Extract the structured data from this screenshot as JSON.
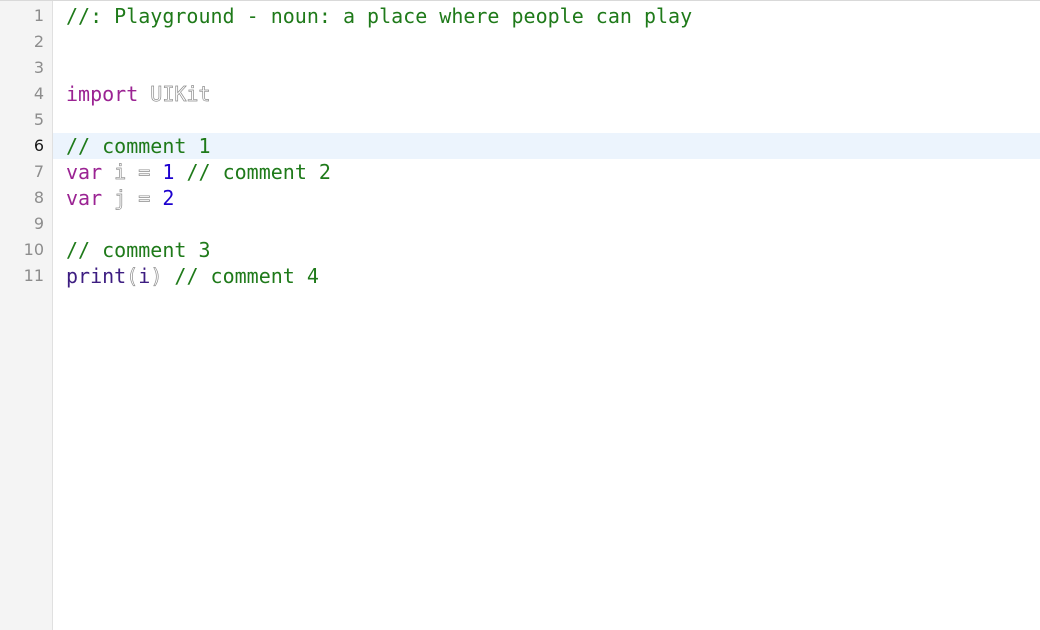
{
  "editor": {
    "current_line": 6,
    "lines": [
      {
        "number": "1",
        "tokens": {
          "comment": "//: Playground - noun: a place where people can play"
        }
      },
      {
        "number": "2",
        "tokens": {}
      },
      {
        "number": "3",
        "tokens": {}
      },
      {
        "number": "4",
        "tokens": {
          "keyword": "import",
          "module": "UIKit"
        }
      },
      {
        "number": "5",
        "tokens": {}
      },
      {
        "number": "6",
        "tokens": {
          "comment": "// comment 1"
        }
      },
      {
        "number": "7",
        "tokens": {
          "keyword": "var",
          "name": "i",
          "equals": "=",
          "value": "1",
          "comment": "// comment 2"
        }
      },
      {
        "number": "8",
        "tokens": {
          "keyword": "var",
          "name": "j",
          "equals": "=",
          "value": "2"
        }
      },
      {
        "number": "9",
        "tokens": {}
      },
      {
        "number": "10",
        "tokens": {
          "comment": "// comment 3"
        }
      },
      {
        "number": "11",
        "tokens": {
          "func": "print",
          "open": "(",
          "arg": "i",
          "close": ")",
          "comment": "// comment 4"
        }
      }
    ]
  },
  "colors": {
    "comment": "#1f7a1a",
    "keyword": "#9b2393",
    "number": "#1c00cf",
    "function": "#3d1d81",
    "current_line_highlight": "#ecf4fd",
    "gutter_background": "#f4f4f4"
  }
}
